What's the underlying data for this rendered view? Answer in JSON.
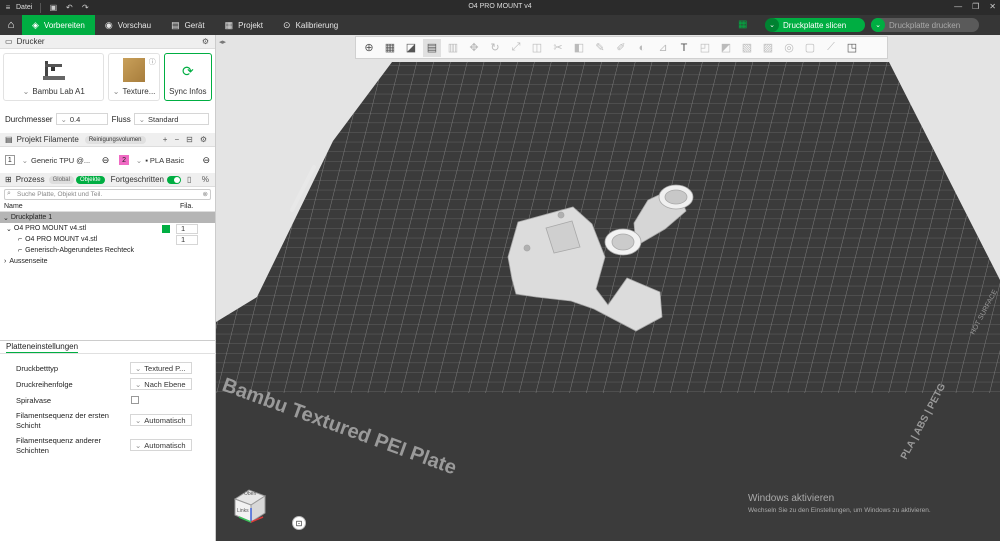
{
  "window": {
    "menu_label": "Datei",
    "title": "O4 PRO MOUNT v4"
  },
  "tabs": [
    {
      "label": "Vorbereiten",
      "icon": "prepare-icon"
    },
    {
      "label": "Vorschau",
      "icon": "preview-icon"
    },
    {
      "label": "Gerät",
      "icon": "device-icon"
    },
    {
      "label": "Projekt",
      "icon": "project-icon"
    },
    {
      "label": "Kalibrierung",
      "icon": "calibration-icon"
    }
  ],
  "actions": {
    "slice": "Druckplatte slicen",
    "print": "Druckplatte drucken"
  },
  "printer": {
    "section": "Drucker",
    "name": "Bambu Lab A1",
    "plate": "Texture...",
    "sync": "Sync Infos",
    "nozzle_label": "Durchmesser",
    "nozzle_value": "0.4",
    "flow_label": "Fluss",
    "flow_value": "Standard"
  },
  "filaments": {
    "section": "Projekt Filamente",
    "purge_label": "Reinigungsvolumen",
    "items": [
      {
        "num": "1",
        "name": "Generic TPU @...",
        "color": "#ffffff"
      },
      {
        "num": "2",
        "name": "PLA Basic",
        "color": "#f06ac4"
      }
    ]
  },
  "process": {
    "section": "Prozess",
    "global_label": "Global",
    "objects_label": "Objekte",
    "advanced_label": "Fortgeschritten",
    "search_placeholder": "Suche Platte, Objekt und Teil."
  },
  "object_list": {
    "col_name": "Name",
    "col_fila": "Fila.",
    "plate": "Druckplatte 1",
    "object": "O4 PRO MOUNT v4.stl",
    "object_fila": "1",
    "parts": [
      {
        "name": "O4 PRO MOUNT v4.stl",
        "fila": "1"
      },
      {
        "name": "Generisch-Abgerundetes Rechteck",
        "fila": ""
      }
    ],
    "other": "Aussenseite"
  },
  "plate_settings": {
    "tab": "Platteneinstellungen",
    "rows": [
      {
        "label": "Druckbetttyp",
        "value": "Textured P..."
      },
      {
        "label": "Druckreihenfolge",
        "value": "Nach Ebene"
      },
      {
        "label": "Spiralvase",
        "value": ""
      },
      {
        "label": "Filamentsequenz der ersten Schicht",
        "value": "Automatisch"
      },
      {
        "label": "Filamentsequenz anderer Schichten",
        "value": "Automatisch"
      }
    ]
  },
  "bed": {
    "plate_text": "Bambu Textured PEI Plate",
    "side_text": "PLA | ABS | PETG",
    "hot_surface": "HOT SURFACE"
  },
  "cube": {
    "top": "Oben",
    "left": "Links"
  },
  "watermark": {
    "line1": "Windows aktivieren",
    "line2": "Wechseln Sie zu den Einstellungen, um Windows zu aktivieren."
  },
  "colors": {
    "accent": "#00ae42",
    "titlebar": "#2b2b2b",
    "menubar": "#363636",
    "plate": "#3d3d3d"
  }
}
